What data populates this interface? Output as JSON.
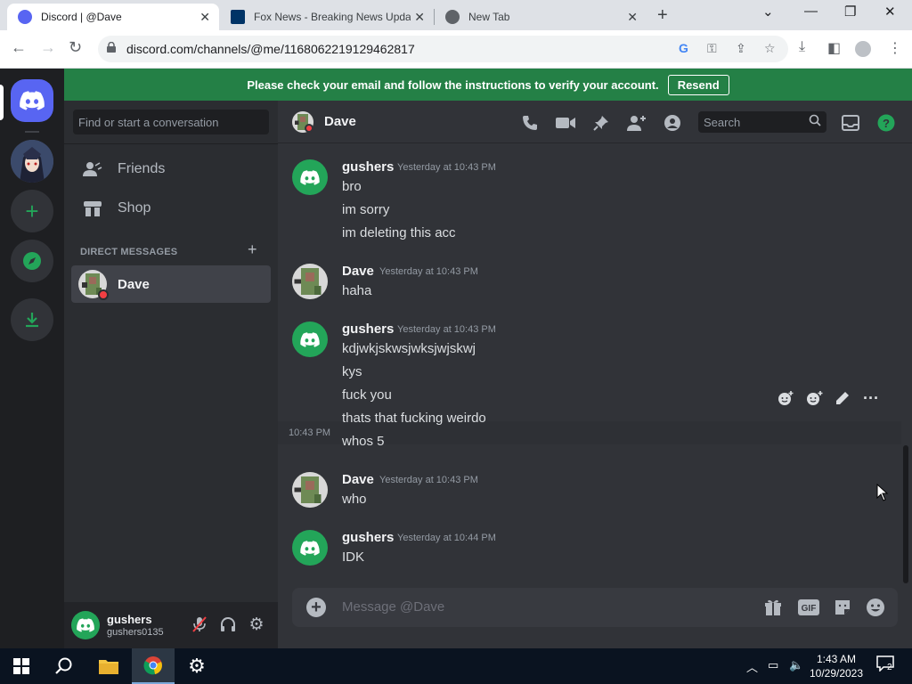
{
  "browser": {
    "tabs": [
      {
        "title": "Discord | @Dave",
        "active": true
      },
      {
        "title": "Fox News - Breaking News Upda",
        "active": false
      },
      {
        "title": "New Tab",
        "active": false
      }
    ],
    "url": "discord.com/channels/@me/1168062219129462817"
  },
  "banner": {
    "text": "Please check your email and follow the instructions to verify your account.",
    "button": "Resend"
  },
  "sidebar": {
    "search_placeholder": "Find or start a conversation",
    "nav": [
      {
        "label": "Friends",
        "icon": "friends-icon"
      },
      {
        "label": "Shop",
        "icon": "shop-icon"
      }
    ],
    "dm_header": "DIRECT MESSAGES",
    "dm_items": [
      {
        "label": "Dave"
      }
    ]
  },
  "user": {
    "name": "gushers",
    "tag": "gushers0135"
  },
  "chat": {
    "title": "Dave",
    "search_placeholder": "Search",
    "composer_placeholder": "Message @Dave",
    "hover_time": "10:43 PM"
  },
  "messages": [
    {
      "author": "gushers",
      "time": "Yesterday at 10:43 PM",
      "lines": [
        "bro",
        "im sorry",
        "im deleting this acc"
      ]
    },
    {
      "author": "Dave",
      "time": "Yesterday at 10:43 PM",
      "lines": [
        "haha"
      ]
    },
    {
      "author": "gushers",
      "time": "Yesterday at 10:43 PM",
      "lines": [
        "kdjwkjskwsjwksjwjskwj",
        "kys",
        "fuck you",
        "thats that fucking weirdo",
        "whos 5"
      ]
    },
    {
      "author": "Dave",
      "time": "Yesterday at 10:43 PM",
      "lines": [
        "who"
      ]
    },
    {
      "author": "gushers",
      "time": "Yesterday at 10:44 PM",
      "lines": [
        "IDK"
      ]
    }
  ],
  "taskbar": {
    "time": "1:43 AM",
    "date": "10/29/2023",
    "notification_count": "2"
  },
  "colors": {
    "discord_blurple": "#5865f2",
    "green": "#23a559",
    "banner_green": "#248046",
    "dnd_red": "#f23f43"
  }
}
